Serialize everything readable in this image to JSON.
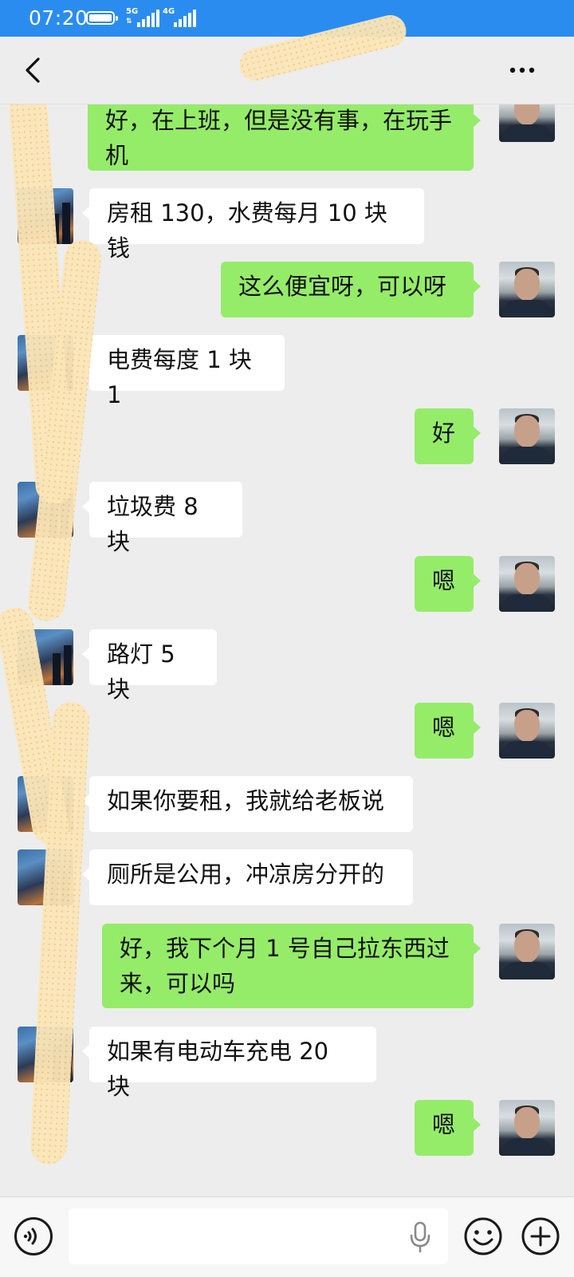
{
  "status_bar": {
    "time": "07:20",
    "network_1": "5G",
    "network_1_sub": "⇅",
    "network_2": "4G",
    "battery_fraction": 1.0,
    "background_color": "#2b8cf0"
  },
  "header": {
    "title": "",
    "back_icon": "chevron-left-icon",
    "more_icon": "more-dots-icon"
  },
  "messages": [
    {
      "side": "right",
      "text": "好，在上班，但是没有事，在玩手机"
    },
    {
      "side": "left",
      "text": "房租 130，水费每月 10 块钱"
    },
    {
      "side": "right",
      "text": "这么便宜呀，可以呀"
    },
    {
      "side": "left",
      "text": "电费每度 1 块 1"
    },
    {
      "side": "right",
      "text": "好"
    },
    {
      "side": "left",
      "text": "垃圾费 8 块"
    },
    {
      "side": "right",
      "text": "嗯"
    },
    {
      "side": "left",
      "text": "路灯 5 块"
    },
    {
      "side": "right",
      "text": "嗯"
    },
    {
      "side": "left",
      "text": "如果你要租，我就给老板说"
    },
    {
      "side": "left",
      "text": "厕所是公用，冲凉房分开的"
    },
    {
      "side": "right",
      "text": "好，我下个月 1 号自己拉东西过来，可以吗"
    },
    {
      "side": "left",
      "text": "如果有电动车充电 20 块"
    },
    {
      "side": "right",
      "text": "嗯"
    }
  ],
  "input_bar": {
    "value": "",
    "voice_icon": "voice-icon",
    "mic_icon": "microphone-icon",
    "emoji_icon": "emoji-icon",
    "plus_icon": "plus-icon"
  },
  "colors": {
    "chat_background": "#ededed",
    "my_bubble": "#95ec69",
    "their_bubble": "#ffffff"
  }
}
